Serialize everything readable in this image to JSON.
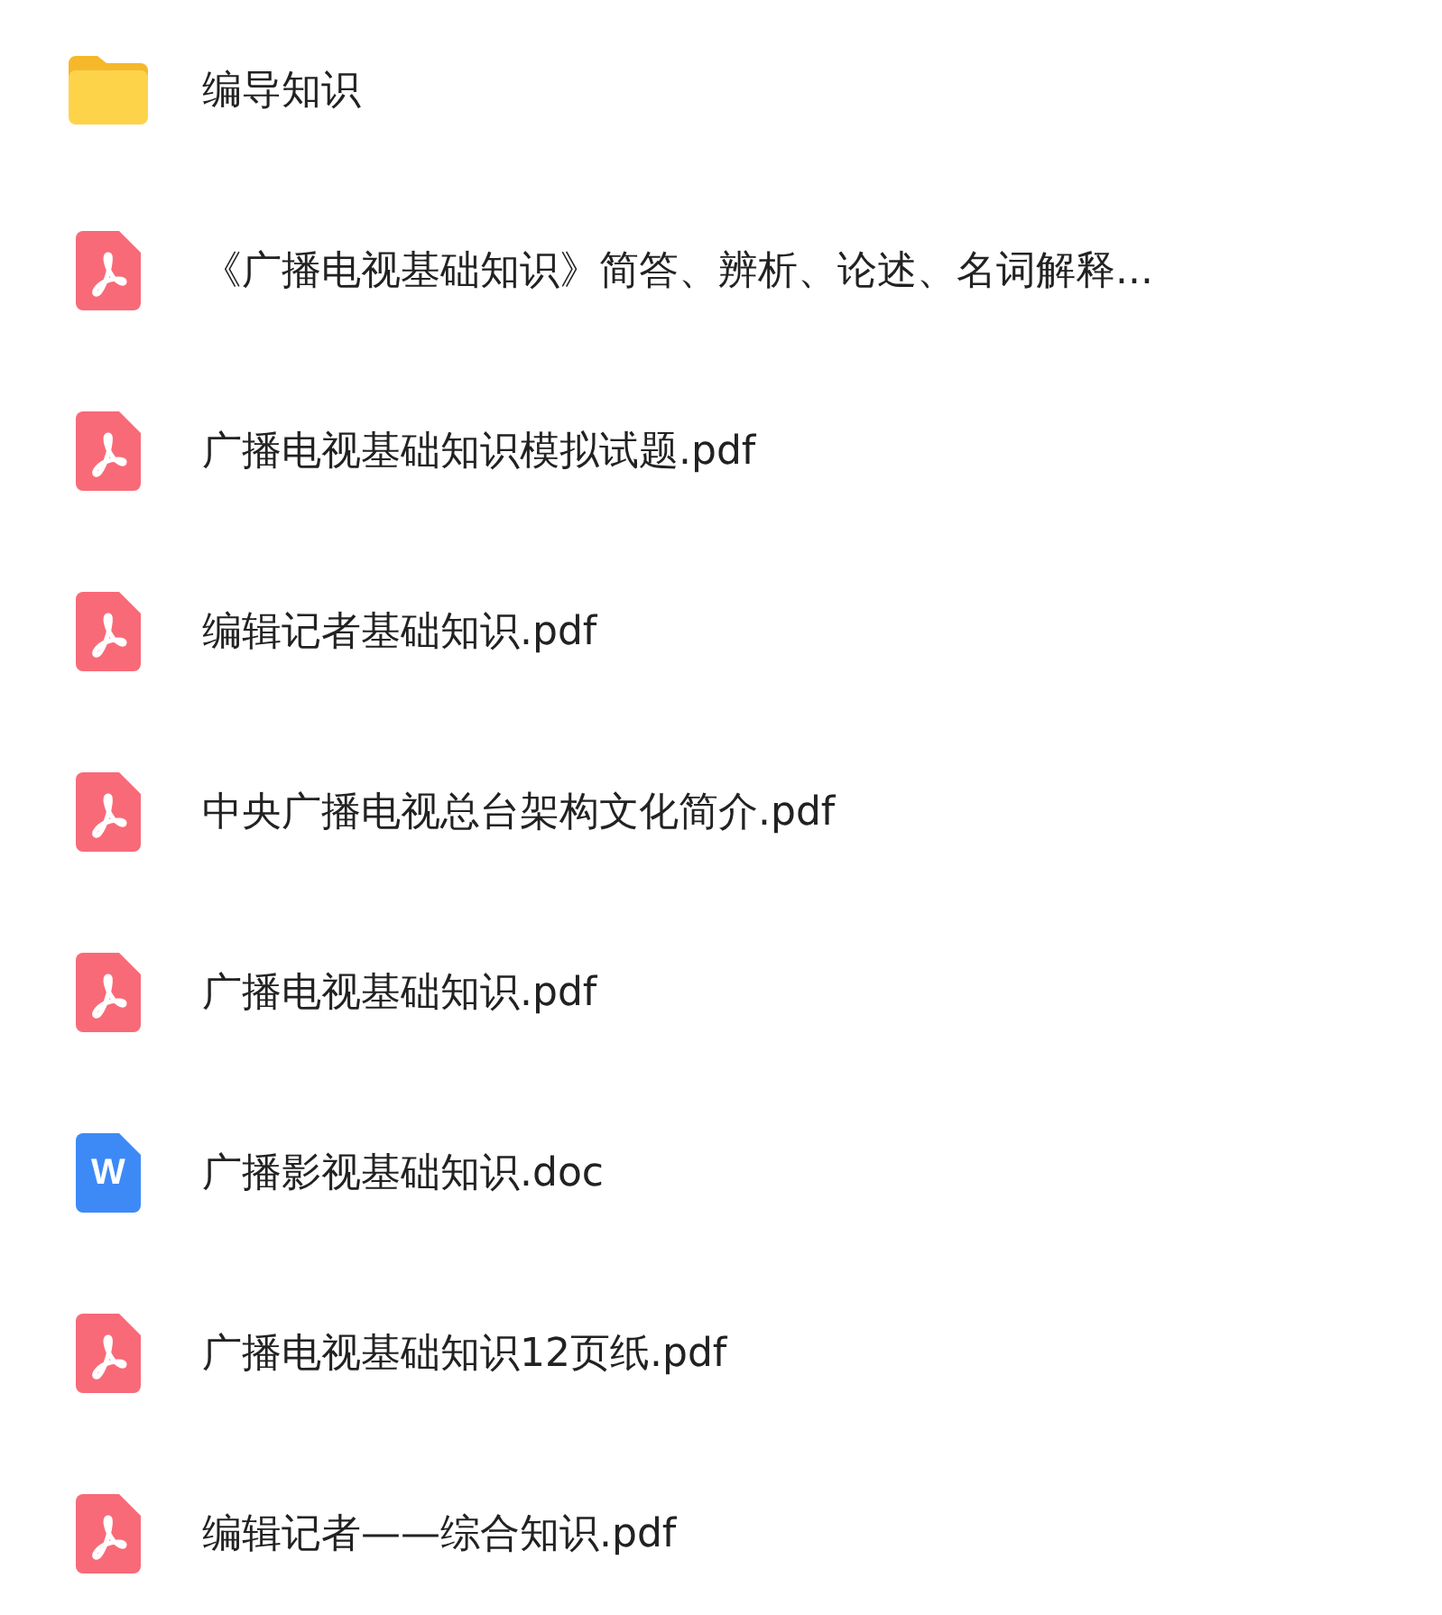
{
  "files": [
    {
      "kind": "folder",
      "name": "编导知识"
    },
    {
      "kind": "pdf",
      "name": "《广播电视基础知识》简答、辨析、论述、名词解释..."
    },
    {
      "kind": "pdf",
      "name": "广播电视基础知识模拟试题.pdf"
    },
    {
      "kind": "pdf",
      "name": "编辑记者基础知识.pdf"
    },
    {
      "kind": "pdf",
      "name": "中央广播电视总台架构文化简介.pdf"
    },
    {
      "kind": "pdf",
      "name": "广播电视基础知识.pdf"
    },
    {
      "kind": "doc",
      "name": "广播影视基础知识.doc",
      "icon_letter": "W"
    },
    {
      "kind": "pdf",
      "name": "广播电视基础知识12页纸.pdf"
    },
    {
      "kind": "pdf",
      "name": "编辑记者——综合知识.pdf"
    }
  ]
}
